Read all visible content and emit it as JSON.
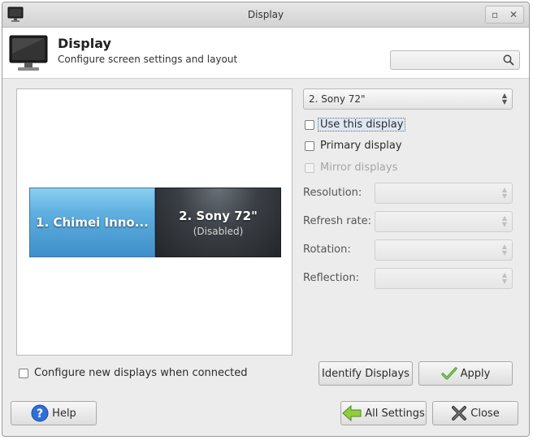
{
  "window": {
    "title": "Display"
  },
  "header": {
    "title": "Display",
    "subtitle": "Configure screen settings and layout"
  },
  "search": {
    "placeholder": ""
  },
  "monitors": [
    {
      "name": "1. Chimei Inno...",
      "sub": ""
    },
    {
      "name": "2. Sony 72\"",
      "sub": "(Disabled)"
    }
  ],
  "display_select": {
    "value": "2. Sony 72\""
  },
  "checkboxes": {
    "use_display": {
      "label": "Use this display",
      "checked": false
    },
    "primary": {
      "label": "Primary display",
      "checked": false
    },
    "mirror": {
      "label": "Mirror displays",
      "checked": false,
      "disabled": true
    },
    "configure_new": {
      "label": "Configure new displays when connected",
      "checked": false
    }
  },
  "fields": {
    "resolution": {
      "label": "Resolution:",
      "value": ""
    },
    "refresh": {
      "label": "Refresh rate:",
      "value": ""
    },
    "rotation": {
      "label": "Rotation:",
      "value": ""
    },
    "reflection": {
      "label": "Reflection:",
      "value": ""
    }
  },
  "buttons": {
    "identify": "Identify Displays",
    "apply": "Apply",
    "help": "Help",
    "all_settings": "All Settings",
    "close": "Close"
  }
}
